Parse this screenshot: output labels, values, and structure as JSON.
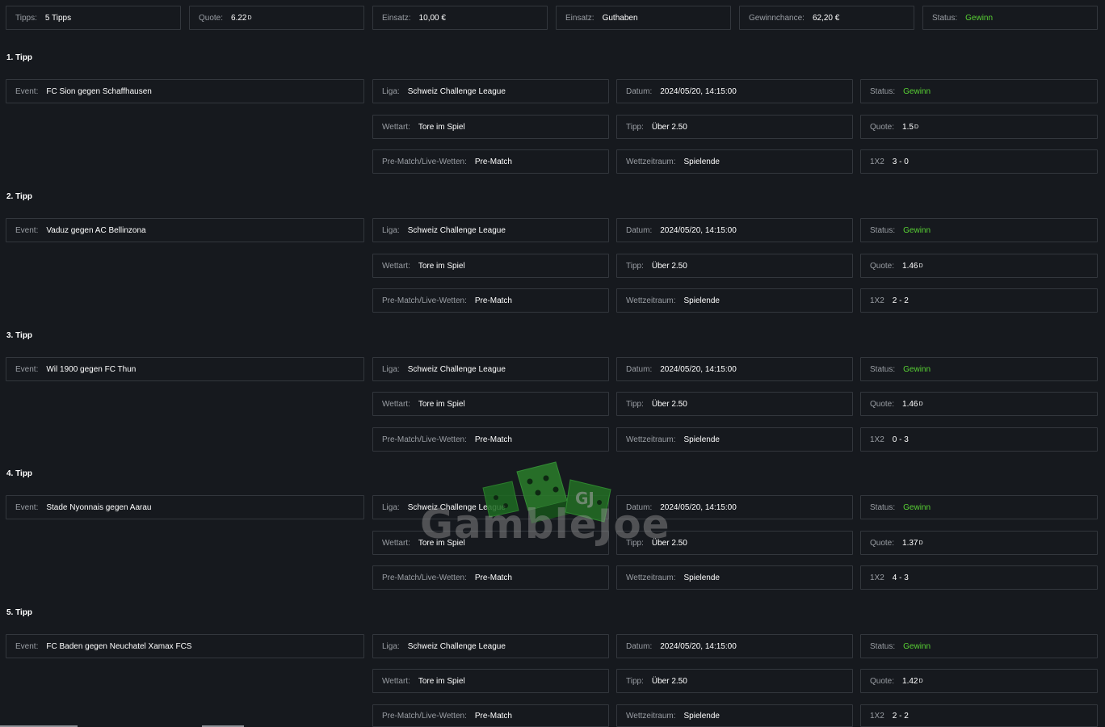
{
  "summary": {
    "tipps": {
      "label": "Tipps:",
      "value": "5 Tipps"
    },
    "quote": {
      "label": "Quote:",
      "value": "6.22"
    },
    "einsatz": {
      "label": "Einsatz:",
      "value": "10,00 €"
    },
    "einsatz_type": {
      "label": "Einsatz:",
      "value": "Guthaben"
    },
    "gewinnchance": {
      "label": "Gewinnchance:",
      "value": "62,20 €"
    },
    "status": {
      "label": "Status:",
      "value": "Gewinn"
    }
  },
  "field_labels": {
    "event": "Event:",
    "liga": "Liga:",
    "datum": "Datum:",
    "status": "Status:",
    "wettart": "Wettart:",
    "tipp": "Tipp:",
    "quote": "Quote:",
    "prematch": "Pre-Match/Live-Wetten:",
    "wettzeitraum": "Wettzeitraum:",
    "x12": "1X2"
  },
  "odds_mark": "D",
  "tipps": [
    {
      "heading": "1. Tipp",
      "event": "FC Sion gegen Schaffhausen",
      "liga": "Schweiz Challenge League",
      "datum": "2024/05/20, 14:15:00",
      "status": "Gewinn",
      "wettart": "Tore im Spiel",
      "tipp": "Über 2.50",
      "quote": "1.5",
      "prematch": "Pre-Match",
      "wettzeitraum": "Spielende",
      "score": "3 - 0"
    },
    {
      "heading": "2. Tipp",
      "event": "Vaduz gegen AC Bellinzona",
      "liga": "Schweiz Challenge League",
      "datum": "2024/05/20, 14:15:00",
      "status": "Gewinn",
      "wettart": "Tore im Spiel",
      "tipp": "Über 2.50",
      "quote": "1.46",
      "prematch": "Pre-Match",
      "wettzeitraum": "Spielende",
      "score": "2 - 2"
    },
    {
      "heading": "3. Tipp",
      "event": "Wil 1900 gegen FC Thun",
      "liga": "Schweiz Challenge League",
      "datum": "2024/05/20, 14:15:00",
      "status": "Gewinn",
      "wettart": "Tore im Spiel",
      "tipp": "Über 2.50",
      "quote": "1.46",
      "prematch": "Pre-Match",
      "wettzeitraum": "Spielende",
      "score": "0 - 3"
    },
    {
      "heading": "4. Tipp",
      "event": "Stade Nyonnais gegen Aarau",
      "liga": "Schweiz Challenge League",
      "datum": "2024/05/20, 14:15:00",
      "status": "Gewinn",
      "wettart": "Tore im Spiel",
      "tipp": "Über 2.50",
      "quote": "1.37",
      "prematch": "Pre-Match",
      "wettzeitraum": "Spielende",
      "score": "4 - 3"
    },
    {
      "heading": "5. Tipp",
      "event": "FC Baden gegen Neuchatel Xamax FCS",
      "liga": "Schweiz Challenge League",
      "datum": "2024/05/20, 14:15:00",
      "status": "Gewinn",
      "wettart": "Tore im Spiel",
      "tipp": "Über 2.50",
      "quote": "1.42",
      "prematch": "Pre-Match",
      "wettzeitraum": "Spielende",
      "score": "2 - 2"
    }
  ],
  "watermark": {
    "text": "GambleJoe",
    "logo_letters": "GJ"
  },
  "colors": {
    "win": "#58d134",
    "background": "#16191e",
    "border": "#33373d"
  }
}
